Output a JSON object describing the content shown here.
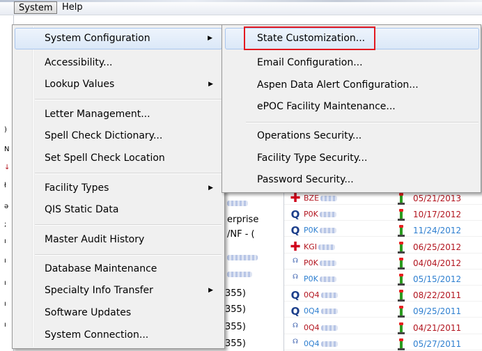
{
  "menubar": {
    "items": [
      {
        "label": "System",
        "active": true
      },
      {
        "label": "Help",
        "active": false
      }
    ]
  },
  "system_menu": {
    "items": [
      {
        "label": "System Configuration",
        "submenu": true,
        "highlighted": true
      },
      {
        "label": "Accessibility...",
        "submenu": false
      },
      {
        "label": "Lookup Values",
        "submenu": true
      },
      {
        "label": "Letter Management...",
        "submenu": false
      },
      {
        "label": "Spell Check Dictionary...",
        "submenu": false
      },
      {
        "label": "Set Spell Check Location",
        "submenu": false
      },
      {
        "label": "Facility Types",
        "submenu": true
      },
      {
        "label": "QIS Static Data",
        "submenu": false
      },
      {
        "label": "Master Audit History",
        "submenu": false
      },
      {
        "label": "Database Maintenance",
        "submenu": false
      },
      {
        "label": "Specialty Info Transfer",
        "submenu": true
      },
      {
        "label": "Software Updates",
        "submenu": false
      },
      {
        "label": "System Connection...",
        "submenu": false
      }
    ]
  },
  "submenu": {
    "items": [
      {
        "label": "State Customization...",
        "highlighted": true,
        "outlined": true,
        "outline_color": "#e3181f"
      },
      {
        "label": "Email Configuration..."
      },
      {
        "label": "Aspen Data Alert Configuration..."
      },
      {
        "label": "ePOC Facility Maintenance..."
      },
      {
        "label": "Operations Security..."
      },
      {
        "label": "Facility Type Security..."
      },
      {
        "label": "Password Security..."
      }
    ]
  },
  "background": {
    "fragments": [
      "erprise",
      "/NF - (",
      "355)",
      "355)",
      "355)",
      "355)"
    ],
    "grid_rows": [
      {
        "icon": "plus-icon",
        "code": "BZE",
        "date": "05/21/2013",
        "color": "#b2141e"
      },
      {
        "icon": "q-icon",
        "code": "P0K",
        "date": "10/17/2012",
        "color": "#b2141e"
      },
      {
        "icon": "q-icon",
        "code": "P0K",
        "date": "11/24/2012",
        "color": "#2e7fd0"
      },
      {
        "icon": "plus-icon",
        "code": "KGI",
        "date": "06/25/2012",
        "color": "#b2141e"
      },
      {
        "icon": "bsc-icon",
        "code": "P0K",
        "date": "04/04/2012",
        "color": "#b2141e"
      },
      {
        "icon": "bsc-icon",
        "code": "P0K",
        "date": "05/15/2012",
        "color": "#2e7fd0"
      },
      {
        "icon": "q-icon",
        "code": "0Q4",
        "date": "08/22/2011",
        "color": "#b2141e"
      },
      {
        "icon": "q-icon",
        "code": "0Q4",
        "date": "09/25/2011",
        "color": "#2e7fd0"
      },
      {
        "icon": "bsc-icon",
        "code": "0Q4",
        "date": "04/21/2011",
        "color": "#b2141e"
      },
      {
        "icon": "bsc-icon",
        "code": "0Q4",
        "date": "05/27/2011",
        "color": "#2e7fd0"
      }
    ]
  }
}
